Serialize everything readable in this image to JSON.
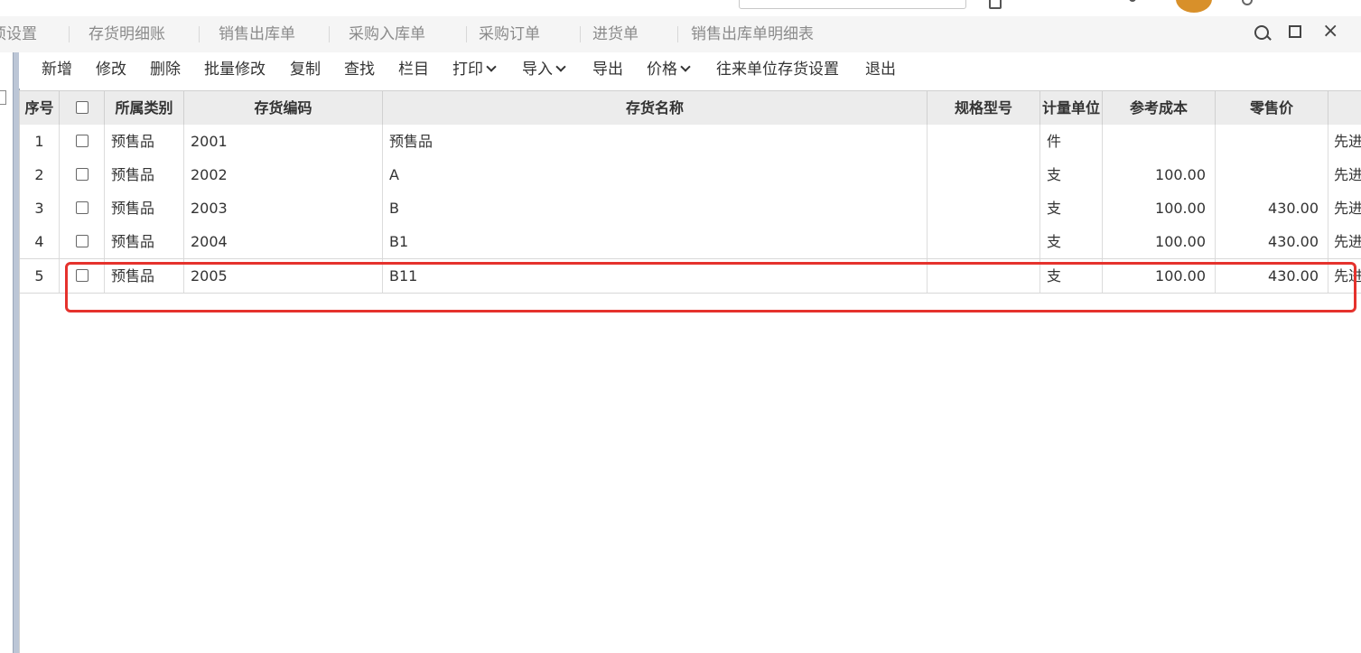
{
  "tabs": [
    "项设置",
    "存货明细账",
    "销售出库单",
    "采购入库单",
    "采购订单",
    "进货单",
    "销售出库单明细表"
  ],
  "toolbar": {
    "new": "新增",
    "edit": "修改",
    "delete": "删除",
    "batch_edit": "批量修改",
    "copy": "复制",
    "find": "查找",
    "columns": "栏目",
    "print": "打印",
    "import": "导入",
    "export": "导出",
    "price": "价格",
    "partner_settings": "往来单位存货设置",
    "exit": "退出"
  },
  "columns": {
    "seq": "序号",
    "category": "所属类别",
    "code": "存货编码",
    "name": "存货名称",
    "spec": "规格型号",
    "unit": "计量单位",
    "ref_cost": "参考成本",
    "retail_price": "零售价"
  },
  "rows": [
    {
      "seq": "1",
      "category": "预售品",
      "code": "2001",
      "name": "预售品",
      "spec": "",
      "unit": "件",
      "ref_cost": "",
      "retail_price": "",
      "extra": "先进"
    },
    {
      "seq": "2",
      "category": "预售品",
      "code": "2002",
      "name": "A",
      "spec": "",
      "unit": "支",
      "ref_cost": "100.00",
      "retail_price": "",
      "extra": "先进"
    },
    {
      "seq": "3",
      "category": "预售品",
      "code": "2003",
      "name": "B",
      "spec": "",
      "unit": "支",
      "ref_cost": "100.00",
      "retail_price": "430.00",
      "extra": "先进"
    },
    {
      "seq": "4",
      "category": "预售品",
      "code": "2004",
      "name": "B1",
      "spec": "",
      "unit": "支",
      "ref_cost": "100.00",
      "retail_price": "430.00",
      "extra": "先进"
    },
    {
      "seq": "5",
      "category": "预售品",
      "code": "2005",
      "name": "B11",
      "spec": "",
      "unit": "支",
      "ref_cost": "100.00",
      "retail_price": "430.00",
      "extra": "先进"
    }
  ],
  "highlight_color": "#e5322d"
}
